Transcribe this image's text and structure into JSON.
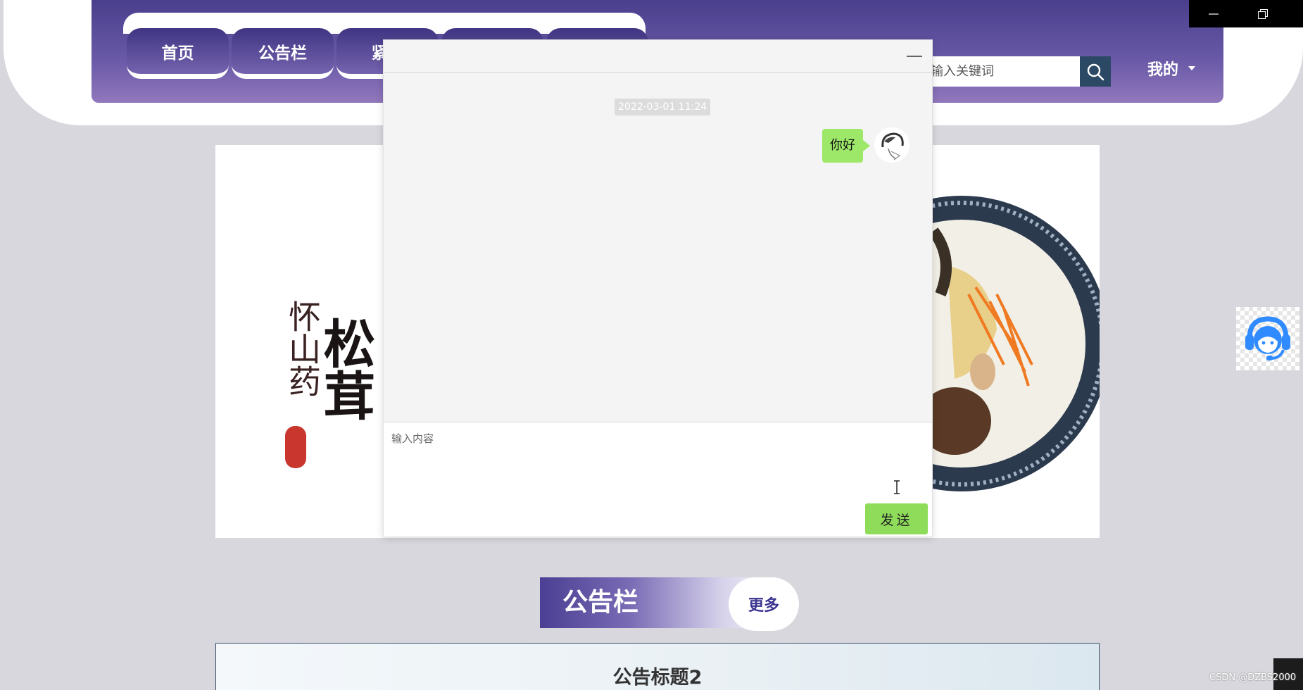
{
  "nav": {
    "items": [
      {
        "label": "首页"
      },
      {
        "label": "公告栏"
      },
      {
        "label": "紧急"
      },
      {
        "label": ""
      },
      {
        "label": ""
      }
    ]
  },
  "search": {
    "placeholder": "输入关键词",
    "icon": "search-icon"
  },
  "user_menu": {
    "label": "我的"
  },
  "banner": {
    "calligraphy_main": "松茸",
    "calligraphy_side": "怀山药"
  },
  "chat": {
    "timestamp": "2022-03-01 11:24",
    "messages": [
      {
        "text": "你好",
        "side": "right"
      }
    ],
    "input_placeholder": "输入内容",
    "send_label": "发送"
  },
  "notice": {
    "section_title": "公告栏",
    "more_label": "更多",
    "first_item_title": "公告标题2"
  },
  "watermark": "CSDN @DZBS2000",
  "colors": {
    "header_purple": "#5a4c9c",
    "send_green": "#8fdc5a",
    "bubble_green": "#9ee869",
    "search_button": "#2b4964",
    "service_blue": "#2f8bff"
  }
}
